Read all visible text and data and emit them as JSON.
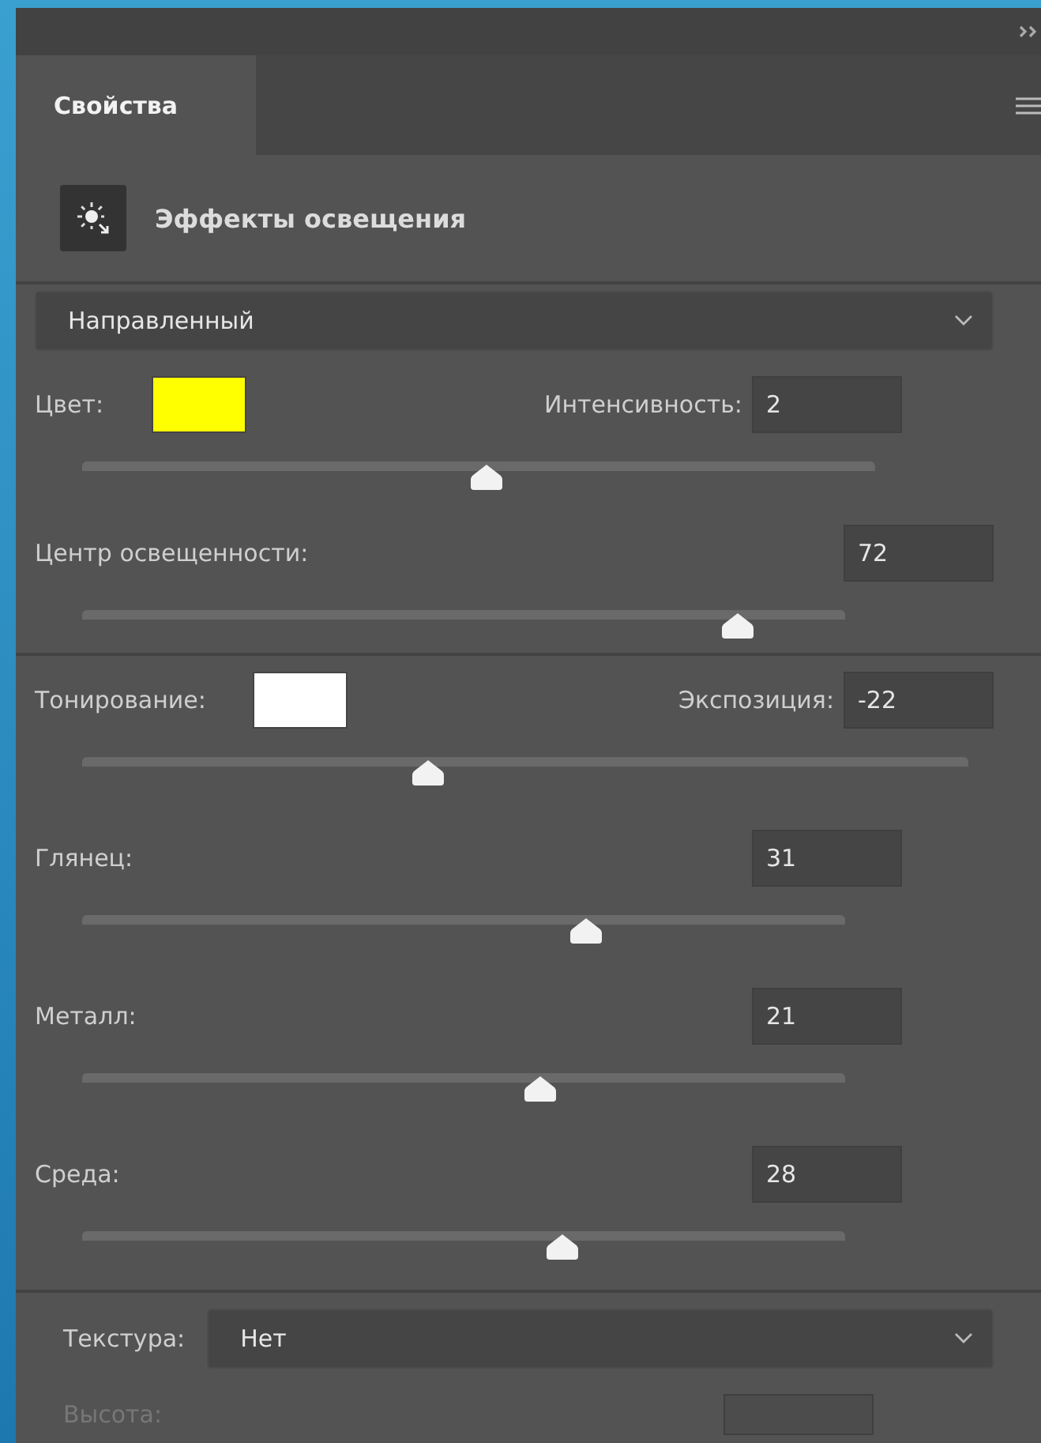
{
  "tabs": [
    {
      "label": "Свойства",
      "selected": true
    }
  ],
  "header": {
    "title": "Эффекты освещения"
  },
  "light_type": {
    "value": "Направленный"
  },
  "light_rows": [
    {
      "kind": "color_value",
      "label": "Цвет:",
      "color": "#ffff00",
      "field_label": "Интенсивность:",
      "value": "2",
      "level": 0.51
    },
    {
      "kind": "value",
      "label": "Центр освещенности:",
      "value": "72",
      "level": 0.86
    }
  ],
  "property_rows": [
    {
      "kind": "color_value",
      "label": "Тонирование:",
      "color": "#ffffff",
      "field_label": "Экспозиция:",
      "value": "-22",
      "level": 0.39
    },
    {
      "kind": "value",
      "label": "Глянец:",
      "value": "31",
      "level": 0.66
    },
    {
      "kind": "value",
      "label": "Металл:",
      "value": "21",
      "level": 0.6
    },
    {
      "kind": "value",
      "label": "Среда:",
      "value": "28",
      "level": 0.63
    }
  ],
  "texture": {
    "label": "Текстура:",
    "value": "Нет"
  },
  "height": {
    "label": "Высота:",
    "disabled": true
  }
}
